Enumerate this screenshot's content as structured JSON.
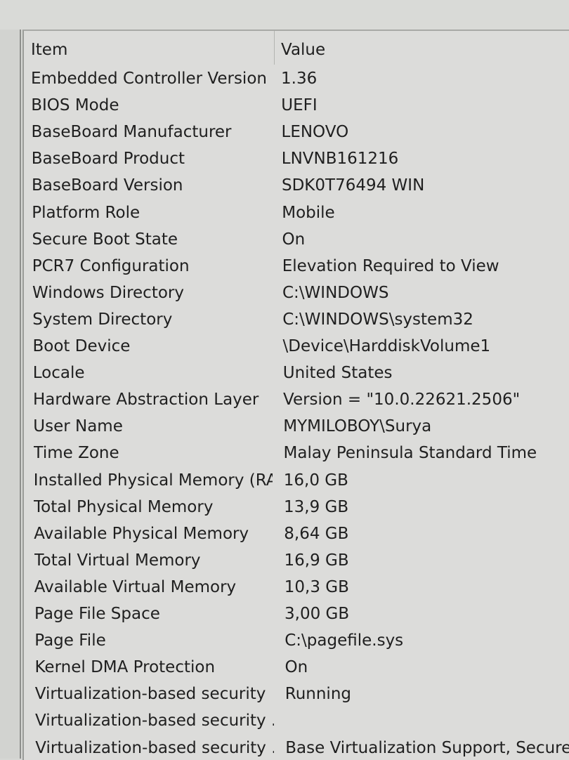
{
  "columns": {
    "item": "Item",
    "value": "Value"
  },
  "rows": [
    {
      "item": "Embedded Controller Version",
      "value": "1.36"
    },
    {
      "item": "BIOS Mode",
      "value": "UEFI"
    },
    {
      "item": "BaseBoard Manufacturer",
      "value": "LENOVO"
    },
    {
      "item": "BaseBoard Product",
      "value": "LNVNB161216"
    },
    {
      "item": "BaseBoard Version",
      "value": "SDK0T76494 WIN"
    },
    {
      "item": "Platform Role",
      "value": "Mobile"
    },
    {
      "item": "Secure Boot State",
      "value": "On"
    },
    {
      "item": "PCR7 Configuration",
      "value": "Elevation Required to View"
    },
    {
      "item": "Windows Directory",
      "value": "C:\\WINDOWS"
    },
    {
      "item": "System Directory",
      "value": "C:\\WINDOWS\\system32"
    },
    {
      "item": "Boot Device",
      "value": "\\Device\\HarddiskVolume1"
    },
    {
      "item": "Locale",
      "value": "United States"
    },
    {
      "item": "Hardware Abstraction Layer",
      "value": "Version = \"10.0.22621.2506\""
    },
    {
      "item": "User Name",
      "value": "MYMILOBOY\\Surya"
    },
    {
      "item": "Time Zone",
      "value": "Malay Peninsula Standard Time"
    },
    {
      "item": "Installed Physical Memory (RA...",
      "value": "16,0 GB"
    },
    {
      "item": "Total Physical Memory",
      "value": "13,9 GB"
    },
    {
      "item": "Available Physical Memory",
      "value": "8,64 GB"
    },
    {
      "item": "Total Virtual Memory",
      "value": "16,9 GB"
    },
    {
      "item": "Available Virtual Memory",
      "value": "10,3 GB"
    },
    {
      "item": "Page File Space",
      "value": "3,00 GB"
    },
    {
      "item": "Page File",
      "value": "C:\\pagefile.sys"
    },
    {
      "item": "Kernel DMA Protection",
      "value": "On"
    },
    {
      "item": "Virtualization-based security",
      "value": "Running"
    },
    {
      "item": "Virtualization-based security ...",
      "value": ""
    },
    {
      "item": "Virtualization-based security ...",
      "value": "Base Virtualization Support, Secure Bo"
    }
  ]
}
